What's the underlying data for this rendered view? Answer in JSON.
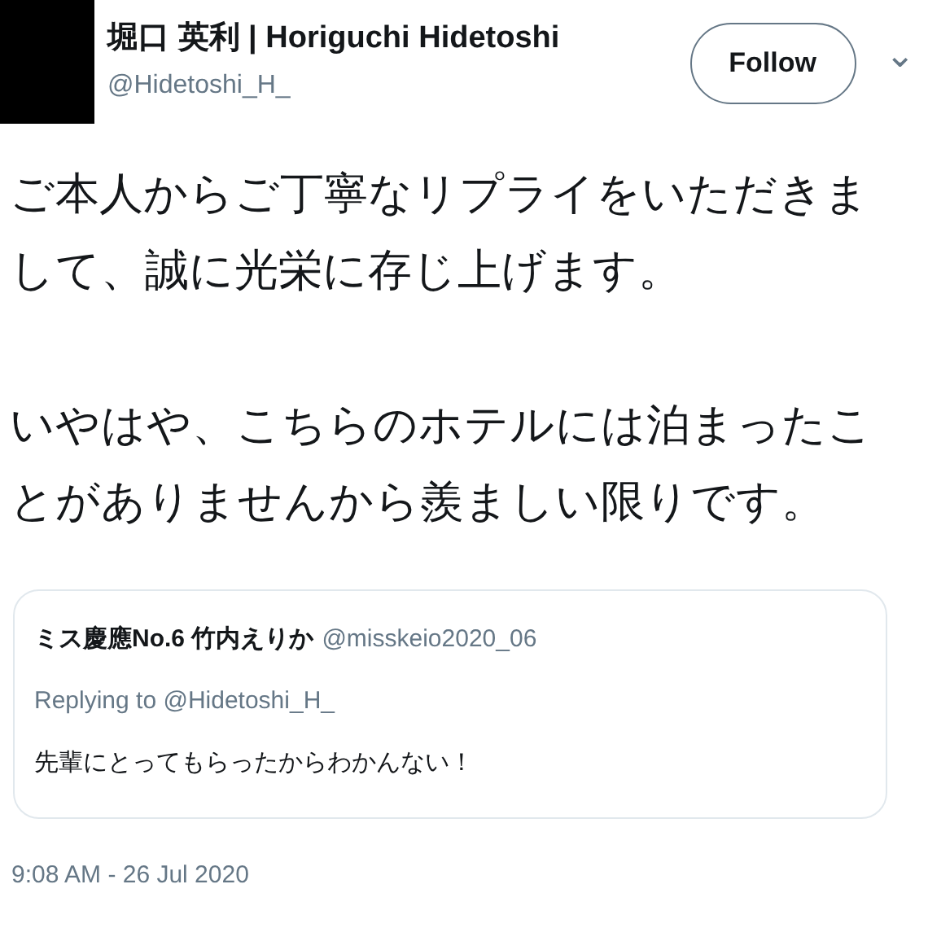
{
  "author": {
    "name": "堀口 英利 | Horiguchi Hidetoshi",
    "handle": "@Hidetoshi_H_"
  },
  "follow_button": {
    "label": "Follow"
  },
  "menu_button": {
    "label": "⌄"
  },
  "tweet": {
    "paragraphs": [
      "ご本人からご丁寧なリプライをいただきまして、誠に光栄に存じ上げます。",
      "いやはや、こちらのホテルには泊まったことがありませんから羨ましい限りです。"
    ]
  },
  "quoted_tweet": {
    "name": "ミス慶應No.6 竹内えりか",
    "handle": "@misskeio2020_06",
    "replying_to": "Replying to @Hidetoshi_H_",
    "text": "先輩にとってもらったからわかんない！"
  },
  "timestamp": "9:08 AM - 26 Jul 2020"
}
